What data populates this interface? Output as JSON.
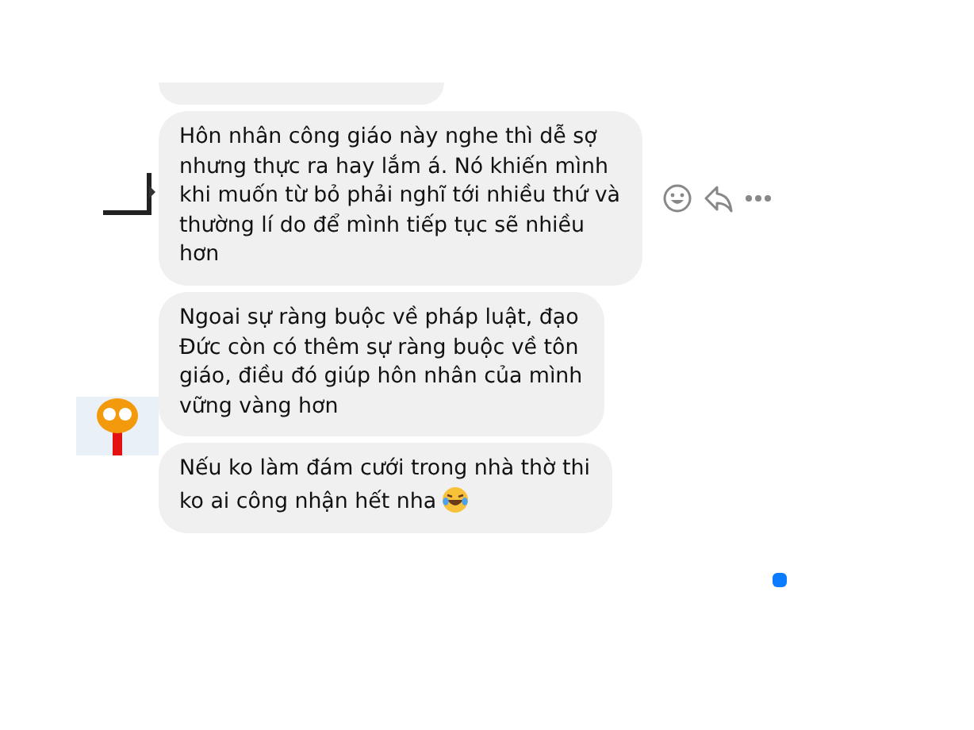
{
  "messages": [
    {
      "text": "Hôn nhân công giáo này nghe thì dễ sợ\nnhưng thực ra hay lắm á. Nó khiến mình\nkhi muốn từ bỏ phải nghĩ tới nhiều thứ và\nthường lí do để mình tiếp tục sẽ nhiều\nhơn",
      "hovered": true
    },
    {
      "text": "Ngoai sự ràng buộc về pháp luật, đạo\nĐức còn có thêm sự ràng buộc về tôn\ngiáo, điều đó giúp hôn nhân của mình\nvững vàng hơn",
      "hovered": false
    },
    {
      "text": "Nếu ko làm đám cưới trong nhà thờ thi\nko ai công nhận hết nha",
      "hovered": false,
      "emoji": true
    }
  ]
}
